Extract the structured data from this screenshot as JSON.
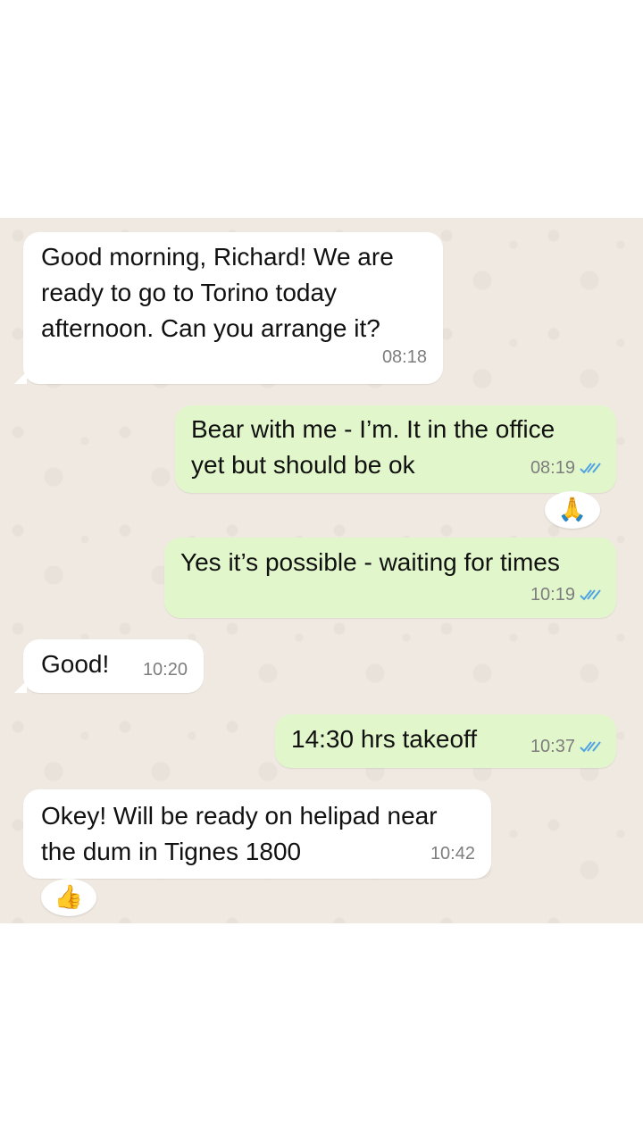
{
  "messages": [
    {
      "direction": "in",
      "text": "Good morning, Richard! We are\nready to go to Torino today\nafternoon. Can you arrange it?",
      "time": "08:18"
    },
    {
      "direction": "out",
      "text": "Bear with me - I’m. It in the office\nyet but should be ok",
      "time": "08:19",
      "status": "read"
    },
    {
      "reaction": "🙏"
    },
    {
      "direction": "out",
      "text": "Yes it’s possible - waiting for times",
      "time": "10:19",
      "status": "read"
    },
    {
      "direction": "in",
      "text": "Good!",
      "time": "10:20"
    },
    {
      "direction": "out",
      "text": "14:30 hrs takeoff",
      "time": "10:37",
      "status": "read"
    },
    {
      "direction": "in",
      "text": "Okey! Will be ready on helipad near\nthe dum in Tignes 1800",
      "time": "10:42"
    },
    {
      "reaction": "👍"
    }
  ],
  "colors": {
    "incoming": "#ffffff",
    "outgoing": "#e1f7cb",
    "read_ticks": "#4fa3e3",
    "chat_bg": "#efe9e1"
  }
}
